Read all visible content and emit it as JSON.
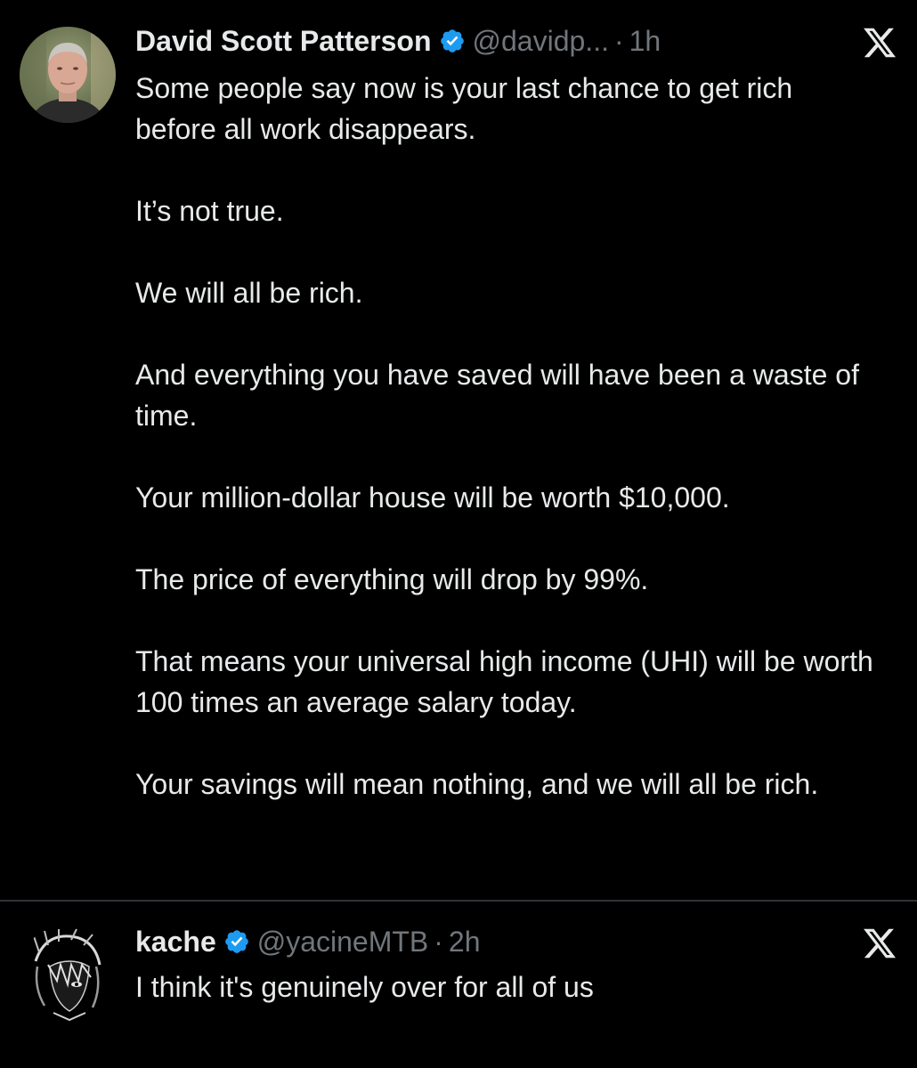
{
  "posts": [
    {
      "author": {
        "name": "David Scott Patterson",
        "handle": "@davidp...",
        "verified": true,
        "avatar": "profile-photo"
      },
      "separator": "·",
      "time": "1h",
      "paragraphs": [
        "Some people say now is your last chance to get rich before all work disappears.",
        "It’s not true.",
        "We will all be rich.",
        "And everything you have saved will have been a waste of time.",
        "Your million-dollar house will be worth $10,000.",
        "The price of everything will drop by 99%.",
        "That means your universal high income (UHI) will be worth 100 times an average salary today.",
        "Your savings will mean nothing, and we will all be rich."
      ],
      "platform_icon": "x-logo-icon"
    },
    {
      "author": {
        "name": "kache",
        "handle": "@yacineMTB",
        "verified": true,
        "avatar": "anime-sketch-avatar"
      },
      "separator": "·",
      "time": "2h",
      "paragraphs": [
        "I think it's genuinely over for all of us"
      ],
      "platform_icon": "x-logo-icon"
    }
  ],
  "colors": {
    "background": "#000000",
    "text": "#e7e9ea",
    "secondary_text": "#71767b",
    "verified_badge": "#1d9bf0",
    "divider": "#2f3336"
  }
}
